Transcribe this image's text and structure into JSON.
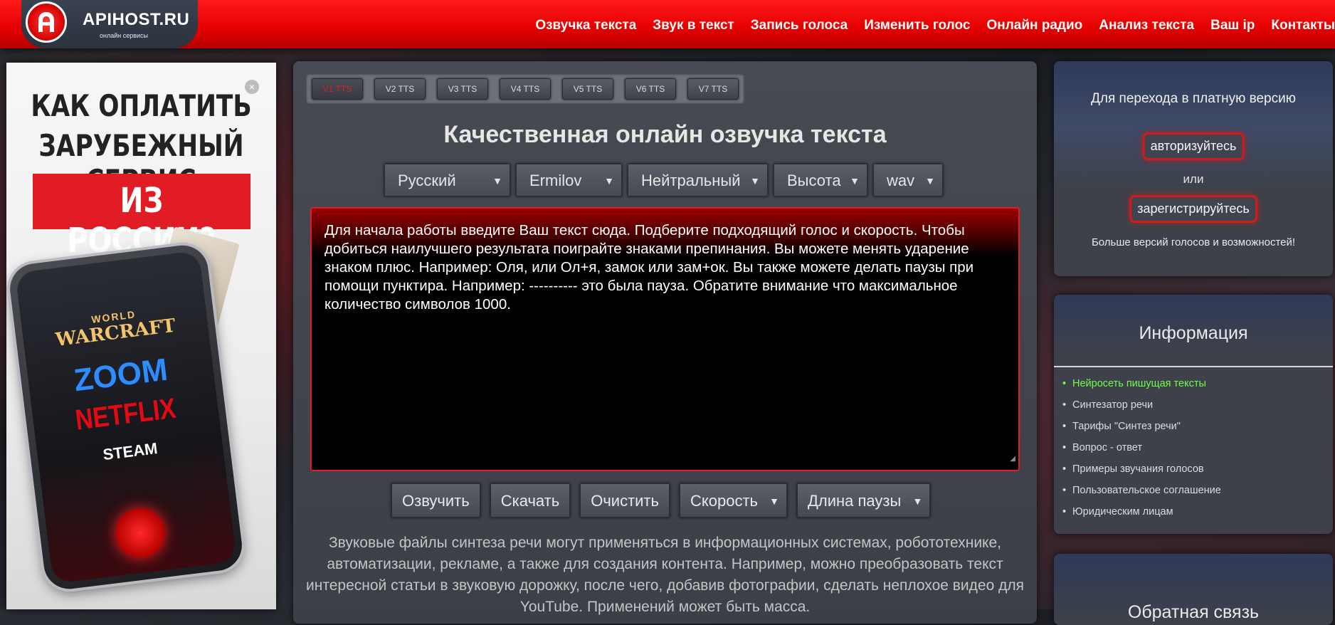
{
  "header": {
    "logo_title": "APIHOST.RU",
    "logo_sub": "онлайн сервисы",
    "nav": [
      "Озвучка текста",
      "Звук в текст",
      "Запись голоса",
      "Изменить голос",
      "Онлайн радио",
      "Анализ текста",
      "Ваш ip",
      "Контакты"
    ]
  },
  "ad": {
    "line1": "КАК ОПЛАТИТЬ",
    "line2": "ЗАРУБЕЖНЫЙ СЕРВИС",
    "line3": "ИЗ РОССИИ?",
    "brands": [
      "WORLD",
      "WARCRAFT",
      "ZOOM",
      "NETFLIX",
      "STEAM"
    ],
    "close": "×"
  },
  "tts": {
    "tabs": [
      "V1 TTS",
      "V2 TTS",
      "V3 TTS",
      "V4 TTS",
      "V5 TTS",
      "V6 TTS",
      "V7 TTS"
    ],
    "active_tab": 0,
    "title": "Качественная онлайн озвучка текста",
    "selects": {
      "language": "Русский",
      "voice": "Ermilov",
      "emotion": "Нейтральный",
      "pitch": "Высота",
      "format": "wav"
    },
    "text": "Для начала работы введите Ваш текст сюда. Подберите подходящий голос и скорость. Чтобы добиться наилучшего результата поиграйте знаками препинания. Вы можете менять ударение знаком плюс. Например: Оля, или Ол+я, замок или зам+ок. Вы также можете делать паузы при помощи пунктира. Например: ---------- это была пауза. Обратите внимание что максимальное количество символов 1000.",
    "buttons": {
      "speak": "Озвучить",
      "download": "Скачать",
      "clear": "Очистить",
      "speed": "Скорость",
      "pause": "Длина паузы"
    },
    "description": "Звуковые файлы синтеза речи могут применяться в информационных системах, робототехнике, автоматизации, рекламе, а также для создания контента. Например, можно преобразовать текст интересной статьи в звуковую дорожку, после чего, добавив фотографии, сделать неплохое видео для YouTube. Применений может быть масса."
  },
  "sidebar": {
    "upgrade_text": "Для перехода в платную версию",
    "login": "авторизуйтесь",
    "or": "или",
    "register": "зарегистрируйтесь",
    "more": "Больше версий голосов и возможностей!",
    "info_title": "Информация",
    "info_items": [
      "Нейросеть пишущая тексты",
      "Синтезатор речи",
      "Тарифы \"Синтез речи\"",
      "Вопрос - ответ",
      "Примеры звучания голосов",
      "Пользовательское соглашение",
      "Юридическим лицам"
    ],
    "highlight_index": 0,
    "third_title": "Обратная связь"
  },
  "colors": {
    "brand_red": "#e21c24",
    "highlight_green": "#6dff4a"
  }
}
